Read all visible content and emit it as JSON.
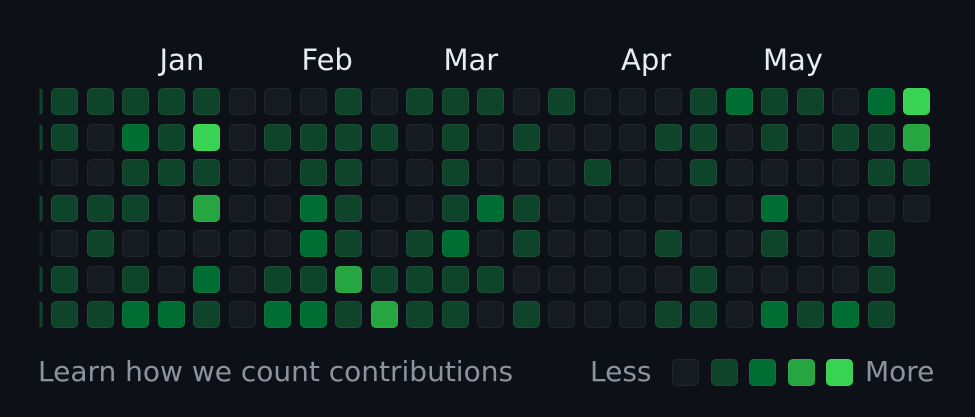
{
  "months": [
    {
      "label": "Jan",
      "col": 4
    },
    {
      "label": "Feb",
      "col": 8
    },
    {
      "label": "Mar",
      "col": 12
    },
    {
      "label": "Apr",
      "col": 17
    },
    {
      "label": "May",
      "col": 21
    }
  ],
  "contributions": {
    "levels": [
      [
        1,
        1,
        1,
        1,
        1,
        0,
        0,
        0,
        1,
        0,
        1,
        1,
        1,
        0,
        1,
        0,
        0,
        0,
        1,
        2,
        1,
        1,
        0,
        2,
        4
      ],
      [
        1,
        0,
        2,
        1,
        4,
        0,
        1,
        1,
        1,
        1,
        0,
        1,
        0,
        1,
        0,
        0,
        0,
        1,
        1,
        0,
        1,
        0,
        1,
        1,
        3
      ],
      [
        0,
        0,
        1,
        1,
        1,
        0,
        0,
        1,
        1,
        0,
        0,
        1,
        0,
        0,
        0,
        1,
        0,
        0,
        1,
        0,
        0,
        0,
        0,
        1,
        1
      ],
      [
        1,
        1,
        1,
        0,
        3,
        0,
        0,
        2,
        1,
        0,
        0,
        1,
        2,
        1,
        0,
        0,
        0,
        0,
        0,
        0,
        2,
        0,
        0,
        0,
        0
      ],
      [
        0,
        1,
        0,
        0,
        0,
        0,
        0,
        2,
        1,
        0,
        1,
        2,
        0,
        1,
        0,
        0,
        0,
        1,
        0,
        0,
        1,
        0,
        0,
        1,
        null
      ],
      [
        1,
        0,
        1,
        0,
        2,
        0,
        1,
        1,
        3,
        1,
        1,
        1,
        1,
        0,
        0,
        0,
        0,
        0,
        1,
        0,
        0,
        0,
        0,
        1,
        null
      ],
      [
        1,
        1,
        2,
        2,
        1,
        0,
        2,
        2,
        1,
        3,
        1,
        1,
        0,
        1,
        0,
        0,
        0,
        1,
        1,
        0,
        2,
        1,
        2,
        1,
        null
      ]
    ]
  },
  "footer": {
    "learn_link": "Learn how we count contributions",
    "legend_less": "Less",
    "legend_more": "More",
    "legend_levels": [
      0,
      1,
      2,
      3,
      4
    ]
  },
  "colors": {
    "level_0": "#161b22",
    "level_1": "#0e4429",
    "level_2": "#006d32",
    "level_3": "#26a641",
    "level_4": "#39d353",
    "text": "#e6edf3",
    "muted_text": "#8b949e"
  }
}
